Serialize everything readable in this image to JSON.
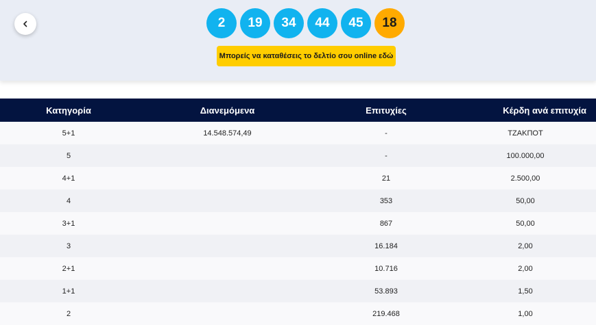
{
  "draw": {
    "numbers": [
      "2",
      "19",
      "34",
      "44",
      "45"
    ],
    "bonus": "18"
  },
  "cta": {
    "label": "Μπορείς να καταθέσεις το δελτίο σου online εδώ"
  },
  "table": {
    "headers": [
      "Κατηγορία",
      "Διανεμόμενα",
      "Επιτυχίες",
      "Κέρδη ανά επιτυχία"
    ],
    "rows": [
      [
        "5+1",
        "14.548.574,49",
        "-",
        "ΤΖΑΚΠΟΤ"
      ],
      [
        "5",
        "",
        "-",
        "100.000,00"
      ],
      [
        "4+1",
        "",
        "21",
        "2.500,00"
      ],
      [
        "4",
        "",
        "353",
        "50,00"
      ],
      [
        "3+1",
        "",
        "867",
        "50,00"
      ],
      [
        "3",
        "",
        "16.184",
        "2,00"
      ],
      [
        "2+1",
        "",
        "10.716",
        "2,00"
      ],
      [
        "1+1",
        "",
        "53.893",
        "1,50"
      ],
      [
        "2",
        "",
        "219.468",
        "1,00"
      ]
    ]
  },
  "colors": {
    "main_ball": "#11b3ef",
    "bonus_ball": "#ffaa00",
    "cta_background": "#ffcd00",
    "table_header": "#031440"
  },
  "icons": {
    "back": "chevron-left-icon"
  }
}
